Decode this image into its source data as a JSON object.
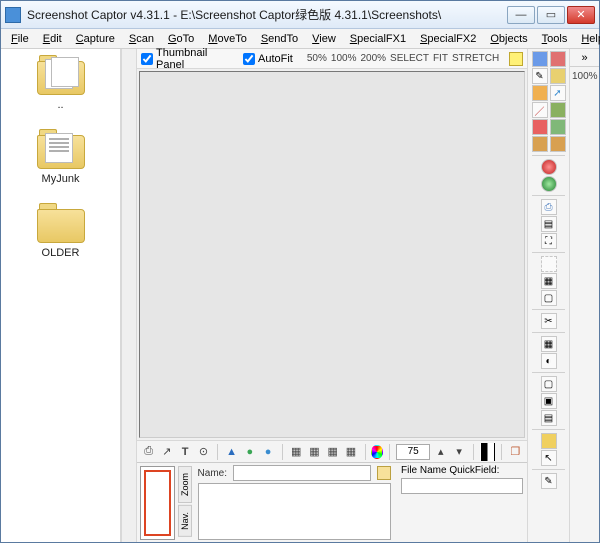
{
  "title": "Screenshot Captor v4.31.1 - E:\\Screenshot Captor绿色版 4.31.1\\Screenshots\\",
  "menu": [
    "File",
    "Edit",
    "Capture",
    "Scan",
    "GoTo",
    "MoveTo",
    "SendTo",
    "View",
    "SpecialFX1",
    "SpecialFX2",
    "Objects",
    "Tools",
    "Help"
  ],
  "sidebar": [
    {
      "label": "..",
      "variant": "docs"
    },
    {
      "label": "MyJunk",
      "variant": "lines"
    },
    {
      "label": "OLDER",
      "variant": "plain"
    }
  ],
  "topbar": {
    "thumbnail_label": "Thumbnail Panel",
    "autofit_label": "AutoFit",
    "zoom_opts": [
      "50%",
      "100%",
      "200%",
      "SELECT",
      "FIT",
      "STRETCH"
    ]
  },
  "toolrow_spin": "75",
  "vtabs": [
    "Zoom",
    "Nav."
  ],
  "fields": {
    "name_label": "Name:",
    "name_value": "",
    "quick_label": "File Name QuickField:",
    "quick_value": ""
  },
  "rightbar_pct": "100%"
}
